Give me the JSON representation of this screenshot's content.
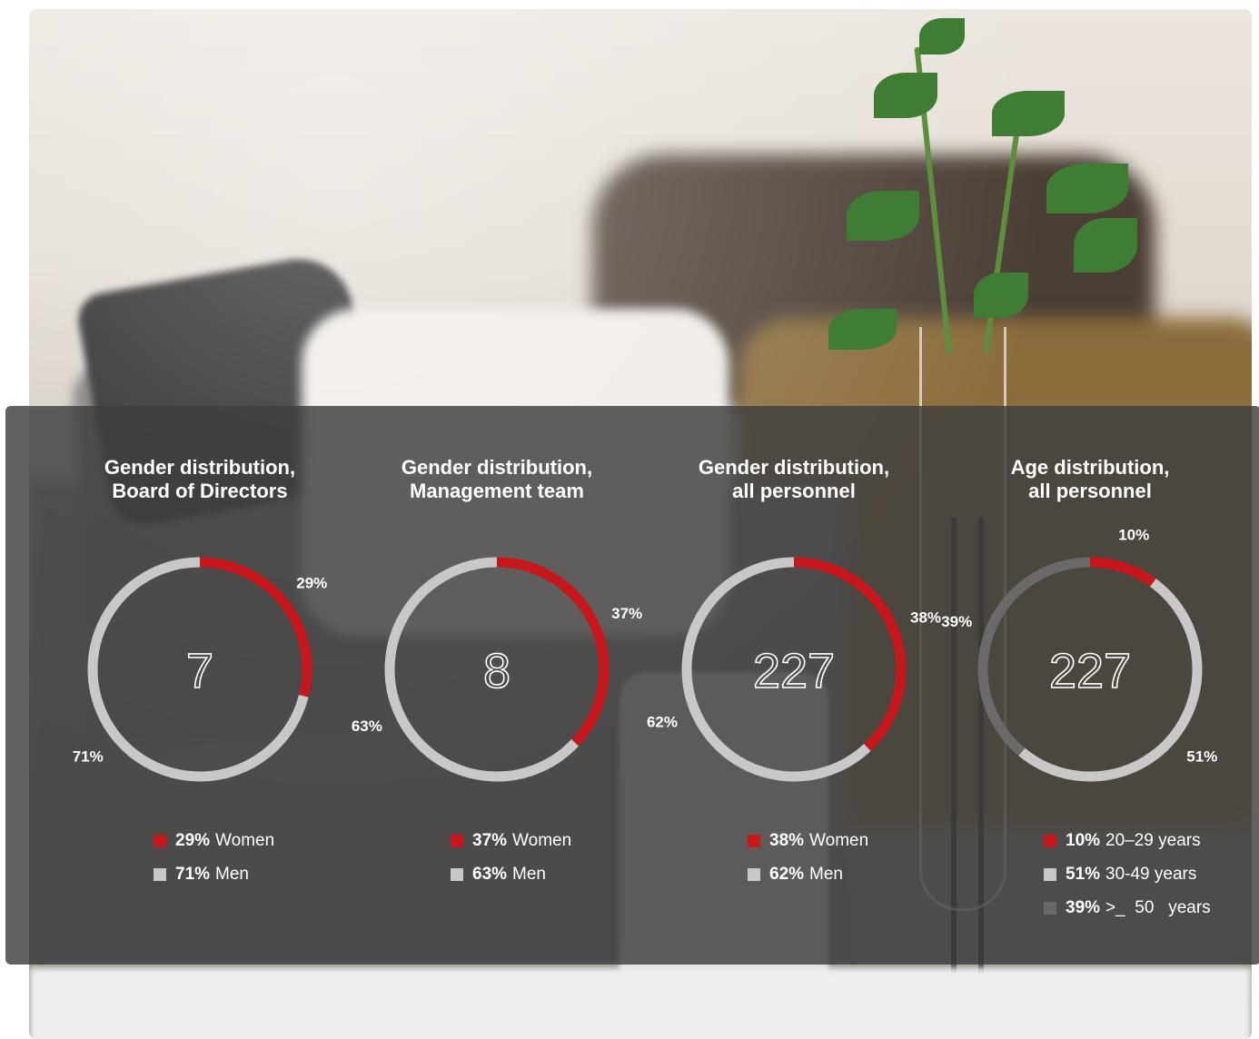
{
  "colors": {
    "women": "#c8161d",
    "men": "#c8c8c8",
    "age_20_29": "#c8161d",
    "age_30_49": "#c8c8c8",
    "age_50_plus": "#6a6a6a",
    "panel": "#3e3e3e"
  },
  "charts": [
    {
      "title_line1": "Gender distribution,",
      "title_line2": "Board of Directors",
      "center": "7",
      "labels": [
        "29%",
        "71%"
      ],
      "legend": [
        {
          "pct": "29%",
          "label": "Women"
        },
        {
          "pct": "71%",
          "label": "Men"
        }
      ]
    },
    {
      "title_line1": "Gender distribution,",
      "title_line2": "Management team",
      "center": "8",
      "labels": [
        "37%",
        "63%"
      ],
      "legend": [
        {
          "pct": "37%",
          "label": "Women"
        },
        {
          "pct": "63%",
          "label": "Men"
        }
      ]
    },
    {
      "title_line1": "Gender distribution,",
      "title_line2": "all personnel",
      "center": "227",
      "labels": [
        "38%",
        "62%"
      ],
      "legend": [
        {
          "pct": "38%",
          "label": "Women"
        },
        {
          "pct": "62%",
          "label": "Men"
        }
      ]
    },
    {
      "title_line1": "Age distribution,",
      "title_line2": "all personnel",
      "center": "227",
      "labels": [
        "10%",
        "51%",
        "39%"
      ],
      "legend": [
        {
          "pct": "10%",
          "label": "20–29 years"
        },
        {
          "pct": "51%",
          "label": "30-49 years"
        },
        {
          "pct": "39%",
          "label": ">_  50   years"
        }
      ]
    }
  ],
  "chart_data": [
    {
      "type": "pie",
      "title": "Gender distribution, Board of Directors",
      "total": 7,
      "categories": [
        "Women",
        "Men"
      ],
      "values": [
        29,
        71
      ],
      "colors": [
        "#c8161d",
        "#c8c8c8"
      ]
    },
    {
      "type": "pie",
      "title": "Gender distribution, Management team",
      "total": 8,
      "categories": [
        "Women",
        "Men"
      ],
      "values": [
        37,
        63
      ],
      "colors": [
        "#c8161d",
        "#c8c8c8"
      ]
    },
    {
      "type": "pie",
      "title": "Gender distribution, all personnel",
      "total": 227,
      "categories": [
        "Women",
        "Men"
      ],
      "values": [
        38,
        62
      ],
      "colors": [
        "#c8161d",
        "#c8c8c8"
      ]
    },
    {
      "type": "pie",
      "title": "Age distribution, all personnel",
      "total": 227,
      "categories": [
        "20–29 years",
        "30-49 years",
        ">_ 50 years"
      ],
      "values": [
        10,
        51,
        39
      ],
      "colors": [
        "#c8161d",
        "#c8c8c8",
        "#6a6a6a"
      ]
    }
  ]
}
